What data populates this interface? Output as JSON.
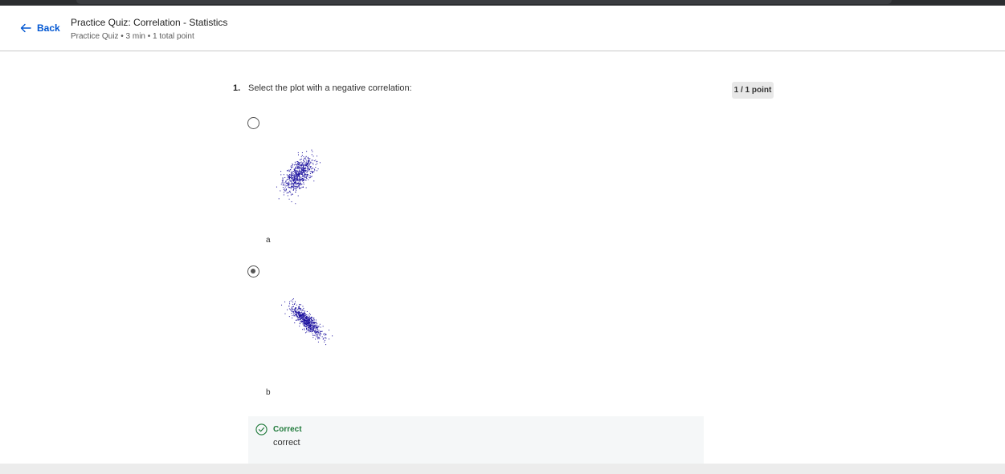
{
  "header": {
    "back_label": "Back",
    "title": "Practice Quiz: Correlation - Statistics",
    "subtitle": "Practice Quiz • 3 min • 1 total point"
  },
  "question": {
    "number": "1.",
    "text": "Select the plot with a negative correlation:",
    "score": "1 / 1 point",
    "options": [
      {
        "label": "a",
        "selected": false,
        "correlation": "positive"
      },
      {
        "label": "b",
        "selected": true,
        "correlation": "negative"
      }
    ]
  },
  "feedback": {
    "status": "Correct",
    "text": "correct"
  },
  "colors": {
    "accent": "#0056d2",
    "correct": "#1f7a3a",
    "scatter": "#1a0f9e"
  }
}
